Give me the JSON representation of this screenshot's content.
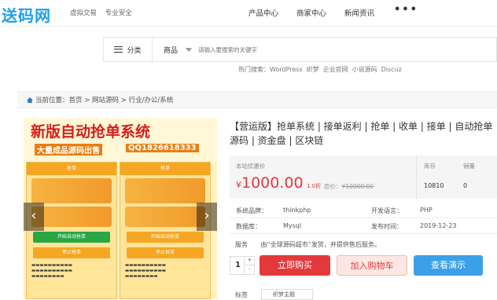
{
  "header": {
    "logo": "送码网",
    "slogans": [
      "虚拟交易",
      "专业安全"
    ],
    "nav": [
      "产品中心",
      "商家中心",
      "新闻资讯"
    ],
    "more": "•••"
  },
  "search": {
    "category_label": "分类",
    "type_label": "商品",
    "placeholder": "请输入要搜索的关键字",
    "hot_label": "热门搜索：",
    "hot_terms": [
      "WordPress",
      "织梦",
      "企业官网",
      "小说源码",
      "Discuz"
    ]
  },
  "breadcrumb": {
    "prefix": "当前位置：",
    "path": "首页 > 网站源码 > 行业/办公/系统"
  },
  "gallery": {
    "banner_title": "新版自动抢单系统",
    "banner_sub1": "大量成品源码出售",
    "banner_sub2": "QQ1826618333",
    "phone_head": "抢单",
    "btn_green": "开始自动抢单",
    "btn_orange": "停止抢单",
    "prev_arrow": "‹",
    "next_arrow": "›"
  },
  "product": {
    "title": "【营运版】抢单系统 | 接单返利 | 抢单 | 收单 | 接单 | 自动抢单源码 | 资金盘 | 区块链",
    "price_label": "本站优惠价",
    "currency": "¥",
    "price": "1000.00",
    "discount": "1.0折",
    "orig_label": "原价：",
    "orig_price": "¥10000.00",
    "stock_label": "库存",
    "stock_value": "10810",
    "sales_label": "销量",
    "sales_value": "0",
    "specs": [
      {
        "k1": "系统品牌：",
        "v1": "thinkphp",
        "k2": "开发语言：",
        "v2": "PHP"
      },
      {
        "k1": "数据库：",
        "v1": "Mysql",
        "k2": "发布时间：",
        "v2": "2019-12-23"
      }
    ],
    "service_label": "服务",
    "service_text": "由“全球源码超市”发货，并提供售后服务。",
    "qty": "1",
    "qty_up": "+",
    "qty_down": "-",
    "buy_label": "立即购买",
    "cart_label": "加入购物车",
    "demo_label": "查看演示",
    "tag_label": "标签",
    "tag_chip": "织梦主题"
  }
}
